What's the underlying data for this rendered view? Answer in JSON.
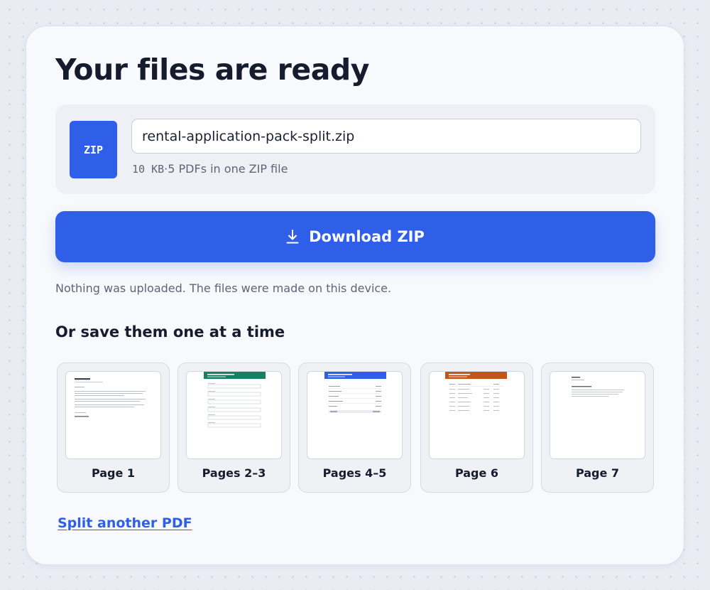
{
  "page": {
    "title": "Your files are ready",
    "notice": "Nothing was uploaded. The files were made on this device.",
    "subheading": "Or save them one at a time"
  },
  "file": {
    "icon_label": "ZIP",
    "name": "rental-application-pack-split.zip",
    "size": "10 KB",
    "separator": "·",
    "description": "5 PDFs in one ZIP file"
  },
  "download": {
    "label": "Download ZIP",
    "icon": "download-icon"
  },
  "parts": [
    {
      "label": "Page 1",
      "preview_header_color": null
    },
    {
      "label": "Pages 2–3",
      "preview_header_color": "#178063"
    },
    {
      "label": "Pages 4–5",
      "preview_header_color": "#2f5fe8"
    },
    {
      "label": "Page 6",
      "preview_header_color": "#c4561c"
    },
    {
      "label": "Page 7",
      "preview_header_color": null
    }
  ],
  "footer": {
    "link_label": "Split another PDF"
  },
  "colors": {
    "accent": "#2f5fe8",
    "background": "#e9ecf3",
    "card": "#f8f9fc",
    "text": "#161b2e",
    "muted": "#5d6577"
  }
}
